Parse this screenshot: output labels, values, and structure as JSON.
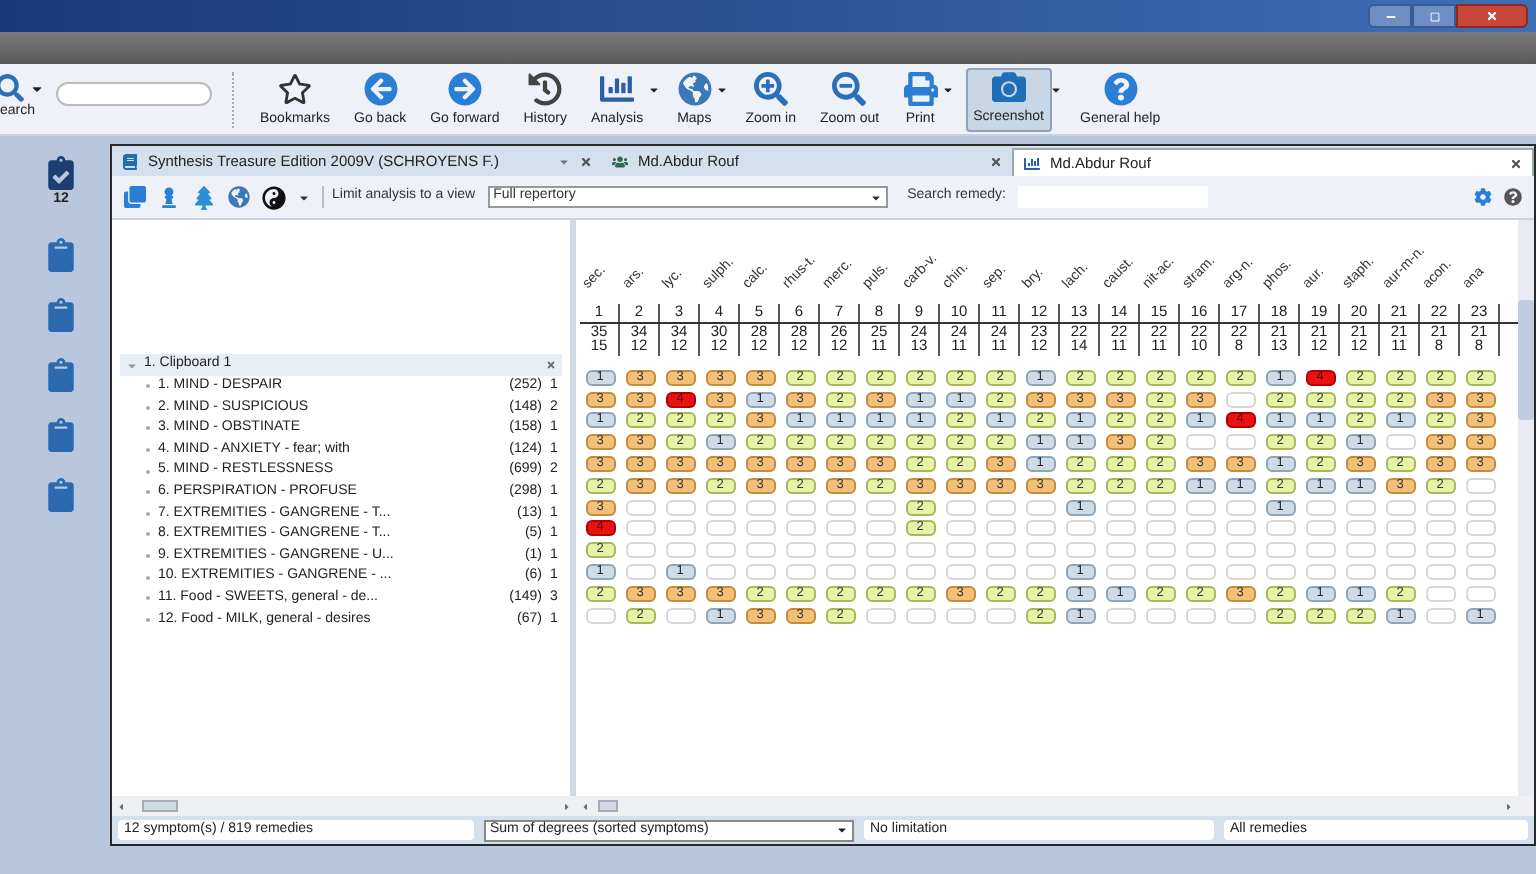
{
  "toolbar": {
    "search_label": "earch",
    "buttons": [
      {
        "label": "Bookmarks",
        "kind": "star",
        "dropdown": false,
        "selected": false
      },
      {
        "label": "Go back",
        "kind": "back",
        "dropdown": false,
        "selected": false
      },
      {
        "label": "Go forward",
        "kind": "forward",
        "dropdown": false,
        "selected": false
      },
      {
        "label": "History",
        "kind": "history",
        "dropdown": false,
        "selected": false
      },
      {
        "label": "Analysis",
        "kind": "chart",
        "dropdown": true,
        "selected": false
      },
      {
        "label": "Maps",
        "kind": "map",
        "dropdown": true,
        "selected": false
      },
      {
        "label": "Zoom in",
        "kind": "zoom-in",
        "dropdown": false,
        "selected": false
      },
      {
        "label": "Zoom out",
        "kind": "zoom-out",
        "dropdown": false,
        "selected": false
      },
      {
        "label": "Print",
        "kind": "print",
        "dropdown": true,
        "selected": false
      },
      {
        "label": "Screenshot",
        "kind": "camera",
        "dropdown": true,
        "selected": true
      },
      {
        "label": "General help",
        "kind": "help",
        "dropdown": false,
        "selected": false
      }
    ]
  },
  "sidebar": {
    "items": [
      {
        "kind": "checked",
        "count": "12"
      },
      {
        "kind": "plain"
      },
      {
        "kind": "plain"
      },
      {
        "kind": "plain"
      },
      {
        "kind": "plain"
      },
      {
        "kind": "plain"
      }
    ]
  },
  "tabs": [
    {
      "label": "Synthesis Treasure Edition 2009V (SCHROYENS F.)",
      "kind": "book",
      "selected": false
    },
    {
      "label": "Md.Abdur Rouf",
      "kind": "people",
      "selected": false
    },
    {
      "label": "Md.Abdur Rouf",
      "kind": "chart",
      "selected": true
    }
  ],
  "view_toolbar": {
    "limit_label": "Limit analysis to a view",
    "limit_value": "Full repertory",
    "search_label": "Search remedy:"
  },
  "tree": {
    "label": "1. Clipboard 1",
    "expanded": true,
    "children": [
      {
        "label": "1. MIND - DESPAIR",
        "count": "(252)",
        "degree": "1"
      },
      {
        "label": "2. MIND - SUSPICIOUS",
        "count": "(148)",
        "degree": "2"
      },
      {
        "label": "3. MIND - OBSTINATE",
        "count": "(158)",
        "degree": "1"
      },
      {
        "label": "4. MIND - ANXIETY - fear; with",
        "count": "(124)",
        "degree": "1"
      },
      {
        "label": "5. MIND - RESTLESSNESS",
        "count": "(699)",
        "degree": "2"
      },
      {
        "label": "6. PERSPIRATION - PROFUSE",
        "count": "(298)",
        "degree": "1"
      },
      {
        "label": "7. EXTREMITIES - GANGRENE - T...",
        "count": "(13)",
        "degree": "1"
      },
      {
        "label": "8. EXTREMITIES - GANGRENE - T...",
        "count": "(5)",
        "degree": "1"
      },
      {
        "label": "9. EXTREMITIES - GANGRENE - U...",
        "count": "(1)",
        "degree": "1"
      },
      {
        "label": "10. EXTREMITIES - GANGRENE - ...",
        "count": "(6)",
        "degree": "1"
      },
      {
        "label": "11. Food - SWEETS, general - de...",
        "count": "(149)",
        "degree": "3"
      },
      {
        "label": "12. Food - MILK, general - desires",
        "count": "(67)",
        "degree": "1"
      }
    ]
  },
  "grid": {
    "remedies": [
      {
        "name": "sec.",
        "number": "1",
        "score": "35",
        "hits": "15"
      },
      {
        "name": "ars.",
        "number": "2",
        "score": "34",
        "hits": "12"
      },
      {
        "name": "lyc.",
        "number": "3",
        "score": "34",
        "hits": "12"
      },
      {
        "name": "sulph.",
        "number": "4",
        "score": "30",
        "hits": "12"
      },
      {
        "name": "calc.",
        "number": "5",
        "score": "28",
        "hits": "12"
      },
      {
        "name": "rhus-t.",
        "number": "6",
        "score": "28",
        "hits": "12"
      },
      {
        "name": "merc.",
        "number": "7",
        "score": "26",
        "hits": "12"
      },
      {
        "name": "puls.",
        "number": "8",
        "score": "25",
        "hits": "11"
      },
      {
        "name": "carb-v.",
        "number": "9",
        "score": "24",
        "hits": "13"
      },
      {
        "name": "chin.",
        "number": "10",
        "score": "24",
        "hits": "11"
      },
      {
        "name": "sep.",
        "number": "11",
        "score": "24",
        "hits": "11"
      },
      {
        "name": "bry.",
        "number": "12",
        "score": "23",
        "hits": "12"
      },
      {
        "name": "lach.",
        "number": "13",
        "score": "22",
        "hits": "14"
      },
      {
        "name": "caust.",
        "number": "14",
        "score": "22",
        "hits": "11"
      },
      {
        "name": "nit-ac.",
        "number": "15",
        "score": "22",
        "hits": "11"
      },
      {
        "name": "stram.",
        "number": "16",
        "score": "22",
        "hits": "10"
      },
      {
        "name": "arg-n.",
        "number": "17",
        "score": "22",
        "hits": "8"
      },
      {
        "name": "phos.",
        "number": "18",
        "score": "21",
        "hits": "13"
      },
      {
        "name": "aur.",
        "number": "19",
        "score": "21",
        "hits": "12"
      },
      {
        "name": "staph.",
        "number": "20",
        "score": "21",
        "hits": "12"
      },
      {
        "name": "aur-m-n.",
        "number": "21",
        "score": "21",
        "hits": "11"
      },
      {
        "name": "acon.",
        "number": "22",
        "score": "21",
        "hits": "8"
      },
      {
        "name": "ana",
        "number": "23",
        "score": "21",
        "hits": "8"
      }
    ],
    "rows": [
      [
        "1",
        "3",
        "3",
        "3",
        "3",
        "2",
        "2",
        "2",
        "2",
        "2",
        "2",
        "1",
        "2",
        "2",
        "2",
        "2",
        "2",
        "1",
        "4",
        "2",
        "2",
        "2",
        "2"
      ],
      [
        "3",
        "3",
        "4",
        "3",
        "1",
        "3",
        "2",
        "3",
        "1",
        "1",
        "2",
        "3",
        "3",
        "3",
        "2",
        "3",
        null,
        "2",
        "2",
        "2",
        "2",
        "3",
        "3"
      ],
      [
        "1",
        "2",
        "2",
        "2",
        "3",
        "1",
        "1",
        "1",
        "1",
        "2",
        "1",
        "2",
        "1",
        "2",
        "2",
        "1",
        "4",
        "1",
        "1",
        "2",
        "1",
        "2",
        "3"
      ],
      [
        "3",
        "3",
        "2",
        "1",
        "2",
        "2",
        "2",
        "2",
        "2",
        "2",
        "2",
        "1",
        "1",
        "3",
        "2",
        null,
        null,
        "2",
        "2",
        "1",
        null,
        "3",
        "3"
      ],
      [
        "3",
        "3",
        "3",
        "3",
        "3",
        "3",
        "3",
        "3",
        "2",
        "2",
        "3",
        "1",
        "2",
        "2",
        "2",
        "3",
        "3",
        "1",
        "2",
        "3",
        "2",
        "3",
        "3"
      ],
      [
        "2",
        "3",
        "3",
        "2",
        "3",
        "2",
        "3",
        "2",
        "3",
        "3",
        "3",
        "3",
        "2",
        "2",
        "2",
        "1",
        "1",
        "2",
        "1",
        "1",
        "3",
        "2",
        null
      ],
      [
        "3",
        null,
        null,
        null,
        null,
        null,
        null,
        null,
        "2",
        null,
        null,
        null,
        "1",
        null,
        null,
        null,
        null,
        "1",
        null,
        null,
        null,
        null,
        null
      ],
      [
        "4",
        null,
        null,
        null,
        null,
        null,
        null,
        null,
        "2",
        null,
        null,
        null,
        null,
        null,
        null,
        null,
        null,
        null,
        null,
        null,
        null,
        null,
        null
      ],
      [
        "2",
        null,
        null,
        null,
        null,
        null,
        null,
        null,
        null,
        null,
        null,
        null,
        null,
        null,
        null,
        null,
        null,
        null,
        null,
        null,
        null,
        null,
        null
      ],
      [
        "1",
        null,
        "1",
        null,
        null,
        null,
        null,
        null,
        null,
        null,
        null,
        null,
        "1",
        null,
        null,
        null,
        null,
        null,
        null,
        null,
        null,
        null,
        null
      ],
      [
        "2",
        "3",
        "3",
        "3",
        "2",
        "2",
        "2",
        "2",
        "2",
        "3",
        "2",
        "2",
        "1",
        "1",
        "2",
        "2",
        "3",
        "2",
        "1",
        "1",
        "2",
        null,
        null
      ],
      [
        null,
        "2",
        null,
        "1",
        "3",
        "3",
        "2",
        null,
        null,
        null,
        null,
        "2",
        "1",
        null,
        null,
        null,
        null,
        "2",
        "2",
        "2",
        "1",
        null,
        "1"
      ]
    ]
  },
  "status_bar": {
    "summary": "12 symptom(s) / 819 remedies",
    "sort": "Sum of degrees (sorted symptoms)",
    "limitation": "No limitation",
    "filter": "All remedies"
  }
}
